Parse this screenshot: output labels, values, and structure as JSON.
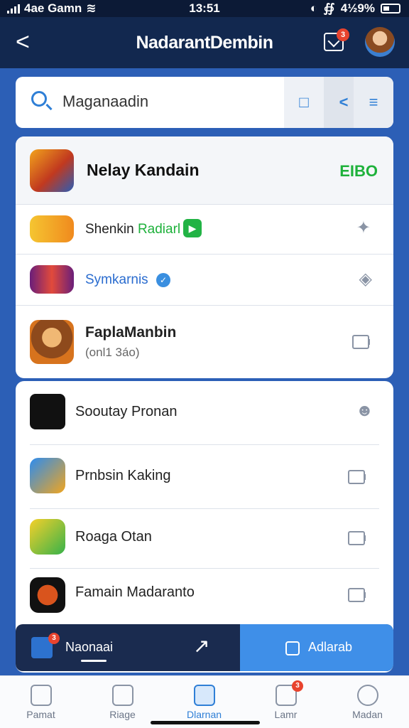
{
  "status": {
    "carrier": "4ae Gamn",
    "time": "13:51",
    "battery": "4½9%"
  },
  "header": {
    "back_label": "<",
    "title": "NadarantDembin",
    "notification_badge": "3"
  },
  "search": {
    "placeholder": "Maganaadin",
    "btn1_icon": "book-icon",
    "btn2_icon": "share-icon",
    "btn3_icon": "menu-icon"
  },
  "card1": {
    "title": "Nelay Kandain",
    "tag": "EIBO",
    "tag_color": "#1eb13b",
    "rows": [
      {
        "label": "Shenkin",
        "label_extra": "Radiarl",
        "action_icon": "pin-icon"
      },
      {
        "label": "Symkarnis",
        "action_icon": "tag-icon"
      },
      {
        "label": "FaplaManbin",
        "sub": "(onl1 3áo)",
        "action_icon": "video-icon"
      }
    ]
  },
  "card2": {
    "rows": [
      {
        "label": "Sooutay Pronan",
        "action_icon": "person-icon"
      },
      {
        "label": "Prnbsin Kaking",
        "action_icon": "video-icon"
      },
      {
        "label": "Roaga Otan",
        "action_icon": "video-icon"
      },
      {
        "label": "Famain Madaranto",
        "action_icon": "video-icon"
      }
    ]
  },
  "bottom_bar": {
    "left_label": "Naonaai",
    "left_badge": "3",
    "right_label": "Adlarab",
    "accent": "#3f8fe8"
  },
  "tabs": [
    {
      "label": "Pamat",
      "icon": "home-icon"
    },
    {
      "label": "Riage",
      "icon": "document-icon"
    },
    {
      "label": "Dlarnan",
      "icon": "checklist-icon",
      "active": true
    },
    {
      "label": "Lamr",
      "icon": "mail-icon",
      "badge": "3"
    },
    {
      "label": "Madan",
      "icon": "profile-icon"
    }
  ]
}
